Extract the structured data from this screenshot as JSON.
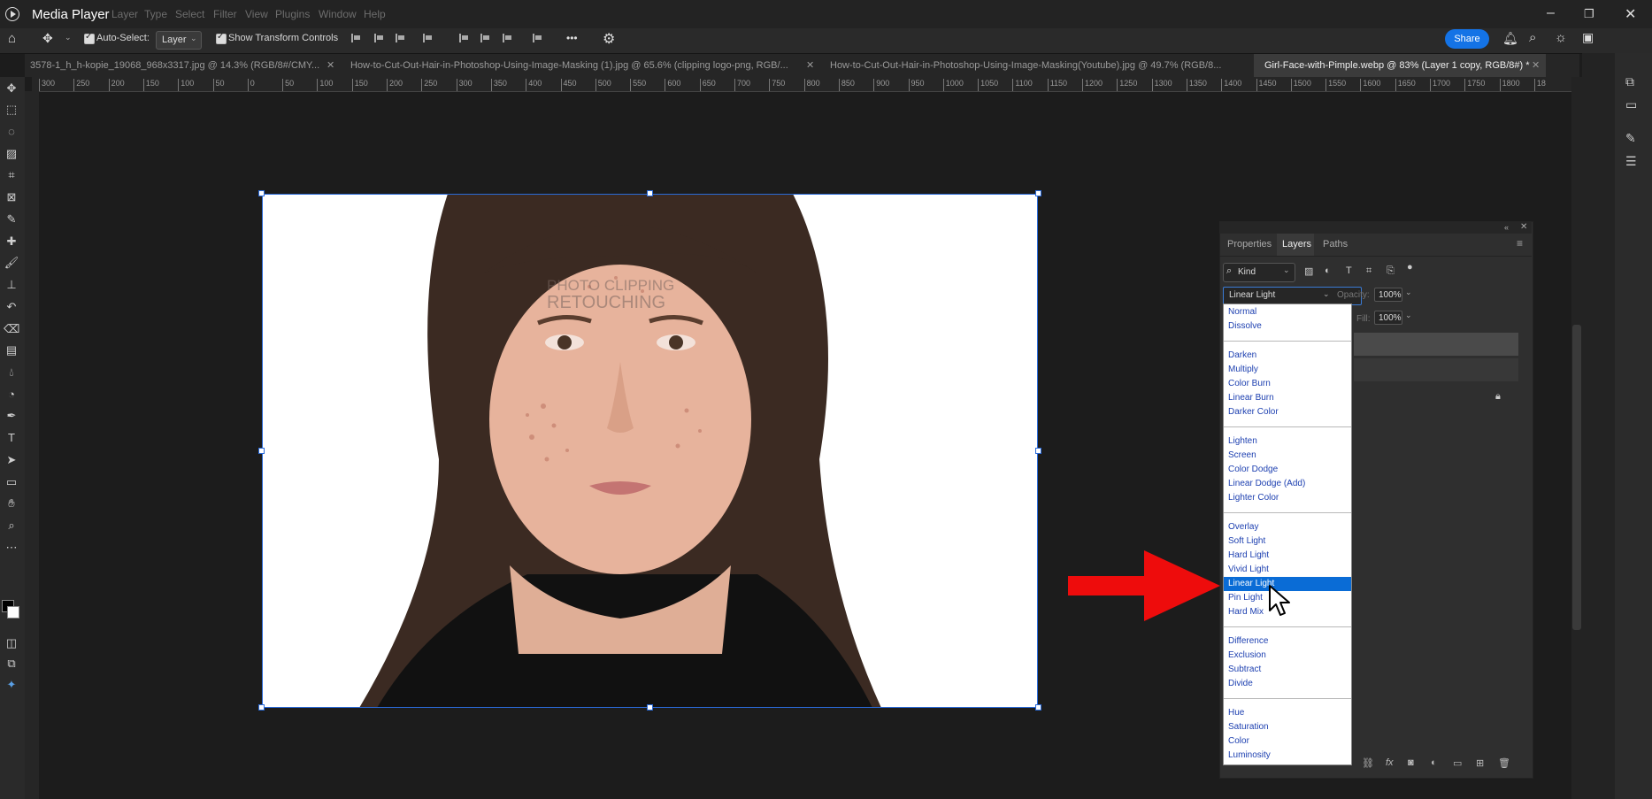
{
  "window": {
    "title": "Media Player",
    "menu": [
      "Layer",
      "Type",
      "Select",
      "Filter",
      "View",
      "Plugins",
      "Window",
      "Help"
    ]
  },
  "options": {
    "auto_select_label": "Auto-Select:",
    "layer_select_value": "Layer",
    "show_transform_label": "Show Transform Controls",
    "more": "•••",
    "share_label": "Share"
  },
  "tabs": [
    {
      "label": "3578-1_h_h-kopie_19068_968x3317.jpg @ 14.3% (RGB/8#/CMY..."
    },
    {
      "label": "How-to-Cut-Out-Hair-in-Photoshop-Using-Image-Masking (1).jpg @ 65.6% (clipping logo-png, RGB/..."
    },
    {
      "label": "How-to-Cut-Out-Hair-in-Photoshop-Using-Image-Masking(Youtube).jpg @ 49.7% (RGB/8..."
    },
    {
      "label": "Girl-Face-with-Pimple.webp @ 83% (Layer 1 copy, RGB/8#) *"
    }
  ],
  "ruler_marks": [
    "300",
    "250",
    "200",
    "150",
    "100",
    "50",
    "0",
    "50",
    "100",
    "150",
    "200",
    "250",
    "300",
    "350",
    "400",
    "450",
    "500",
    "550",
    "600",
    "650",
    "700",
    "750",
    "800",
    "850",
    "900",
    "950",
    "1000",
    "1050",
    "1100",
    "1150",
    "1200",
    "1250",
    "1300",
    "1350",
    "1400",
    "1450",
    "1500",
    "1550",
    "1600",
    "1650",
    "1700",
    "1750",
    "1800",
    "18"
  ],
  "canvas": {
    "watermark_line1": "PHOTO CLIPPING",
    "watermark_line2": "RETOUCHING"
  },
  "layers_panel": {
    "tabs": [
      "Properties",
      "Layers",
      "Paths"
    ],
    "kind_label": "Kind",
    "blend_mode_value": "Linear Light",
    "opacity_label": "Opacity:",
    "opacity_value": "100%",
    "fill_label": "Fill:",
    "fill_value": "100%",
    "blend_groups": [
      [
        "Normal",
        "Dissolve"
      ],
      [
        "Darken",
        "Multiply",
        "Color Burn",
        "Linear Burn",
        "Darker Color"
      ],
      [
        "Lighten",
        "Screen",
        "Color Dodge",
        "Linear Dodge (Add)",
        "Lighter Color"
      ],
      [
        "Overlay",
        "Soft Light",
        "Hard Light",
        "Vivid Light",
        "Linear Light",
        "Pin Light",
        "Hard Mix"
      ],
      [
        "Difference",
        "Exclusion",
        "Subtract",
        "Divide"
      ],
      [
        "Hue",
        "Saturation",
        "Color",
        "Luminosity"
      ]
    ],
    "selected_mode": "Linear Light"
  },
  "colors": {
    "accent": "#1473e6",
    "selection": "#0a6cd6",
    "arrow": "#ee0c0c"
  }
}
